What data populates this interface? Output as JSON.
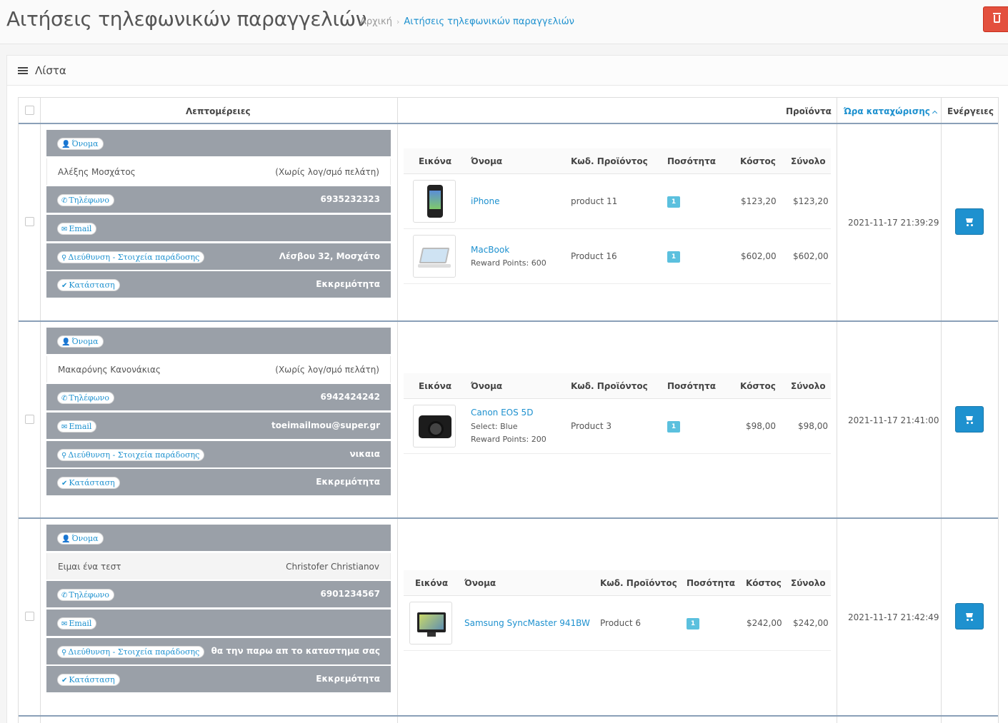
{
  "header": {
    "title": "Αιτήσεις τηλεφωνικών παραγγελιών",
    "breadcrumb_home": "Αρχική",
    "breadcrumb_sep": "›",
    "breadcrumb_current": "Αιτήσεις τηλεφωνικών παραγγελιών",
    "delete_icon": "trash-icon"
  },
  "panel": {
    "title": "Λίστα",
    "icon": "list-icon"
  },
  "table": {
    "col_details": "Λεπτομέρειες",
    "col_products": "Προϊόντα",
    "col_time": "Ώρα καταχώρισης",
    "col_actions": "Ενέργειες"
  },
  "labels": {
    "name": "Όνομα",
    "phone": "Τηλέφωνο",
    "email": "Email",
    "address": "Διεύθυνση - Στοιχεία παράδοσης",
    "status": "Κατάσταση",
    "p_image": "Εικόνα",
    "p_name": "Όνομα",
    "p_code": "Κωδ. Προϊόντος",
    "p_qty": "Ποσότητα",
    "p_cost": "Κόστος",
    "p_total": "Σύνολο"
  },
  "requests": [
    {
      "customer_name": "Αλέξης Μοσχάτος",
      "note": "(Χωρίς λογ/σμό πελάτη)",
      "phone": "6935232323",
      "email": "",
      "address": "Λέσβου 32, Μοσχάτο",
      "status": "Εκκρεμότητα",
      "time": "2021-11-17 21:39:29",
      "products": [
        {
          "name": "iPhone",
          "option": "",
          "reward": "",
          "code": "product 11",
          "qty": "1",
          "cost": "$123,20",
          "total": "$123,20",
          "image_icon": "iphone-image"
        },
        {
          "name": "MacBook",
          "option": "",
          "reward": "Reward Points: 600",
          "code": "Product 16",
          "qty": "1",
          "cost": "$602,00",
          "total": "$602,00",
          "image_icon": "macbook-image"
        }
      ]
    },
    {
      "customer_name": "Μακαρόνης Κανονάκιας",
      "note": "(Χωρίς λογ/σμό πελάτη)",
      "phone": "6942424242",
      "email": "toeimailmou@super.gr",
      "address": "νικαια",
      "status": "Εκκρεμότητα",
      "time": "2021-11-17 21:41:00",
      "products": [
        {
          "name": "Canon EOS 5D",
          "option": "Select: Blue",
          "reward": "Reward Points: 200",
          "code": "Product 3",
          "qty": "1",
          "cost": "$98,00",
          "total": "$98,00",
          "image_icon": "camera-image"
        }
      ]
    },
    {
      "customer_name": "Ειμαι ένα τεστ",
      "note": "Christofer Christianov",
      "phone": "6901234567",
      "email": "",
      "address": "θα την παρω απ το καταστημα σας",
      "status": "Εκκρεμότητα",
      "time": "2021-11-17 21:42:49",
      "products": [
        {
          "name": "Samsung SyncMaster 941BW",
          "option": "",
          "reward": "",
          "code": "Product 6",
          "qty": "1",
          "cost": "$242,00",
          "total": "$242,00",
          "image_icon": "monitor-image"
        }
      ]
    }
  ],
  "icons": {
    "name": "user-icon",
    "phone": "phone-icon",
    "email": "envelope-icon",
    "address": "map-marker-icon",
    "status": "check-icon",
    "action": "cart-icon"
  },
  "colors": {
    "accent": "#1e91cf",
    "danger": "#e3503e",
    "detail_bar": "#9aa0a8",
    "badge": "#5bc0de"
  }
}
